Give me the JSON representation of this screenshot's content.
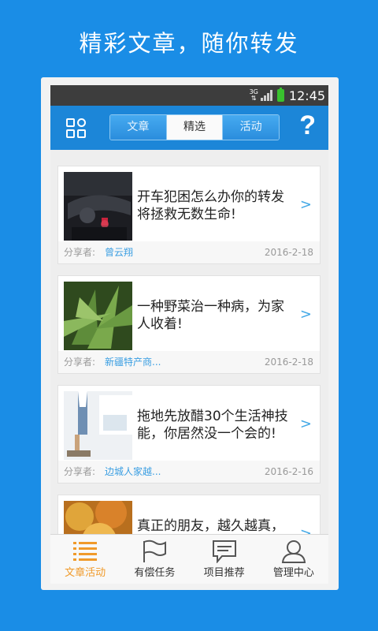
{
  "promo": {
    "title": "精彩文章，随你转发"
  },
  "status_bar": {
    "network": "3G",
    "time": "12:45"
  },
  "header": {
    "tabs": [
      {
        "label": "文章",
        "active": false
      },
      {
        "label": "精选",
        "active": true
      },
      {
        "label": "活动",
        "active": false
      }
    ],
    "help": "?"
  },
  "articles": [
    {
      "title": "开车犯困怎么办你的转发将拯救无数生命!",
      "sharer_label": "分享者:",
      "sharer": "曾云翔",
      "date": "2016-2-18",
      "arrow": ">"
    },
    {
      "title": "一种野菜治一种病，为家人收着!",
      "sharer_label": "分享者:",
      "sharer": "新疆特产商...",
      "date": "2016-2-18",
      "arrow": ">"
    },
    {
      "title": "拖地先放醋30个生活神技能，你居然没一个会的!",
      "sharer_label": "分享者:",
      "sharer": "边城人家越...",
      "date": "2016-2-16",
      "arrow": ">"
    },
    {
      "title": "真正的朋友，越久越真，越淡越纯",
      "sharer_label": "",
      "sharer": "",
      "date": "",
      "arrow": ">"
    }
  ],
  "tabbar": [
    {
      "label": "文章活动",
      "icon": "list-icon",
      "active": true
    },
    {
      "label": "有偿任务",
      "icon": "flag-icon",
      "active": false
    },
    {
      "label": "项目推荐",
      "icon": "chat-icon",
      "active": false
    },
    {
      "label": "管理中心",
      "icon": "user-icon",
      "active": false
    }
  ],
  "colors": {
    "background": "#1a8de6",
    "appbar": "#1c86d8",
    "accent": "#3a9ee2",
    "active_tab": "#f09a2a"
  }
}
